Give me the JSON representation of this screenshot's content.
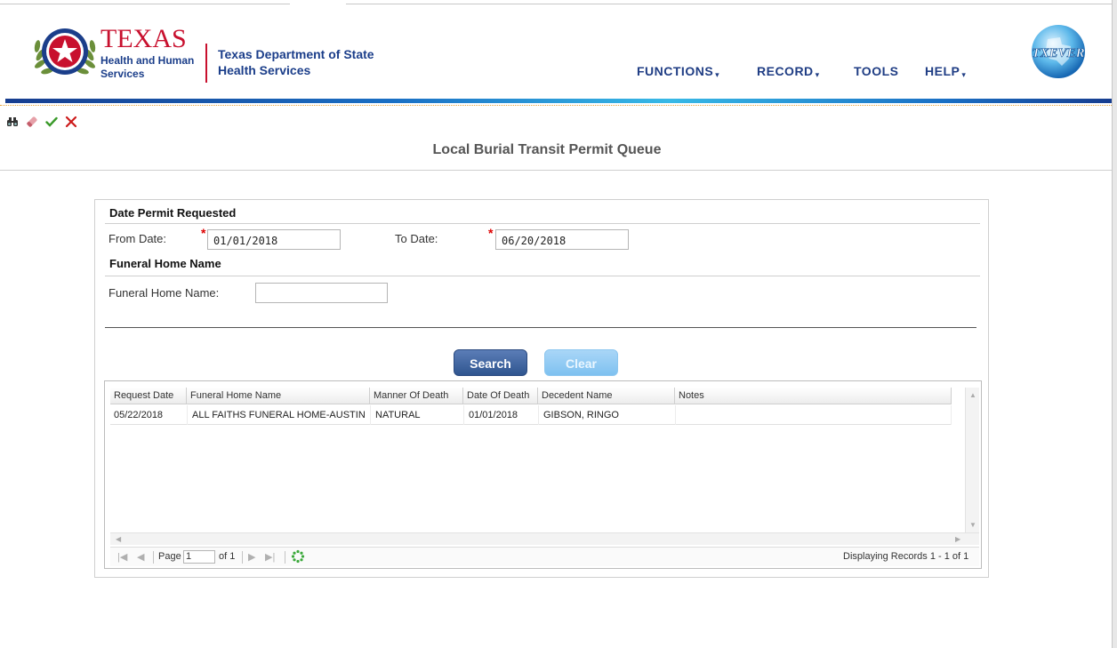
{
  "header": {
    "logo_texas": "TEXAS",
    "logo_hhs_line1": "Health and Human",
    "logo_hhs_line2": "Services",
    "logo_dshs_line1": "Texas Department of State",
    "logo_dshs_line2": "Health Services",
    "nav": [
      {
        "label": "FUNCTIONS",
        "has_dropdown": true
      },
      {
        "label": "RECORD",
        "has_dropdown": true
      },
      {
        "label": "TOOLS",
        "has_dropdown": false
      },
      {
        "label": "HELP",
        "has_dropdown": true
      }
    ],
    "caret": "▾",
    "txever_logo_text": "TXEVER"
  },
  "toolbar": {
    "icons": [
      "binoculars-icon",
      "eraser-icon",
      "checkmark-icon",
      "close-icon"
    ]
  },
  "page": {
    "title": "Local Burial Transit Permit Queue"
  },
  "form": {
    "section1_title": "Date Permit Requested",
    "from_label": "From Date:",
    "from_value": "01/01/2018",
    "to_label": "To Date:",
    "to_value": "06/20/2018",
    "required_marker": "*",
    "section2_title": "Funeral Home Name",
    "funeral_label": "Funeral Home Name:",
    "funeral_value": "",
    "search_label": "Search",
    "clear_label": "Clear"
  },
  "grid": {
    "columns": [
      "Request Date",
      "Funeral Home Name",
      "Manner Of Death",
      "Date Of Death",
      "Decedent Name",
      "Notes"
    ],
    "rows": [
      [
        "05/22/2018",
        "ALL FAITHS FUNERAL HOME-AUSTIN",
        "NATURAL",
        "01/01/2018",
        "GIBSON, RINGO",
        ""
      ]
    ],
    "pager": {
      "page_label": "Page",
      "page_value": "1",
      "of_label": "of 1",
      "display_text": "Displaying Records 1 - 1 of 1"
    }
  },
  "colors": {
    "brand_navy": "#1f3d84",
    "texas_red": "#c8102e",
    "search_button": "#3a5f9a",
    "clear_button": "#8fc9f2"
  }
}
